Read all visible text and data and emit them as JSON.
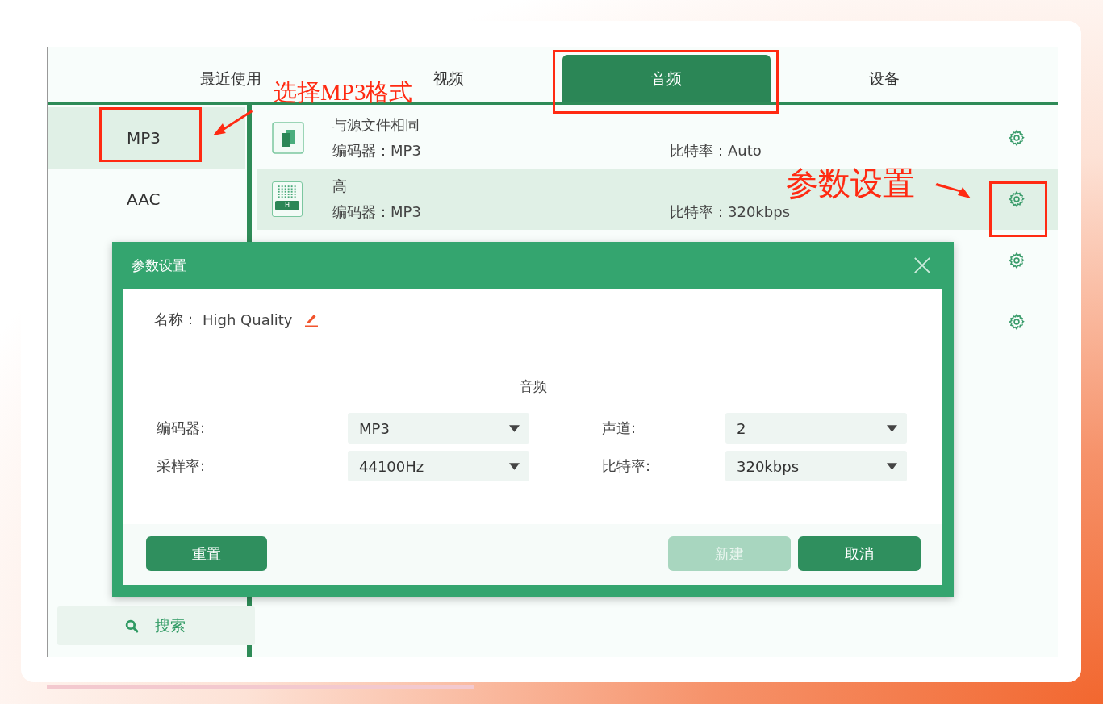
{
  "tabs": [
    {
      "label": "最近使用",
      "selected": false
    },
    {
      "label": "视频",
      "selected": false
    },
    {
      "label": "音频",
      "selected": true
    },
    {
      "label": "设备",
      "selected": false
    }
  ],
  "formats": [
    {
      "label": "MP3",
      "selected": true
    },
    {
      "label": "AAC",
      "selected": false
    }
  ],
  "search_button": {
    "label": "搜索"
  },
  "presets": [
    {
      "kind": "same",
      "title": "与源文件相同",
      "codec": "编码器：MP3",
      "bitrate": "比特率：Auto",
      "selected": false
    },
    {
      "kind": "high",
      "badge": "H",
      "title": "高",
      "codec": "编码器：MP3",
      "bitrate": "比特率：320kbps",
      "selected": true
    },
    {
      "selected": false
    },
    {
      "selected": false
    }
  ],
  "dialog": {
    "title": "参数设置",
    "name_label": "名称：",
    "name_value": "High Quality",
    "section": "音频",
    "fields": [
      {
        "label": "编码器:",
        "value": "MP3"
      },
      {
        "label": "声道:",
        "value": "2"
      },
      {
        "label": "采样率:",
        "value": "44100Hz"
      },
      {
        "label": "比特率:",
        "value": "320kbps"
      }
    ],
    "buttons": [
      {
        "label": "重置",
        "disabled": false
      },
      {
        "label": "新建",
        "disabled": true
      },
      {
        "label": "取消",
        "disabled": false
      }
    ]
  },
  "annotations": [
    {
      "text": "选择MP3格式"
    },
    {
      "text": "参数设置"
    }
  ]
}
